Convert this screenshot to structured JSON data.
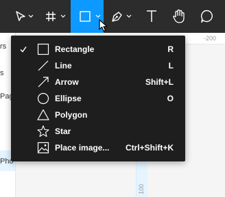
{
  "toolbar": {
    "tools": [
      {
        "name": "move-tool"
      },
      {
        "name": "frame-tool"
      },
      {
        "name": "shape-tool",
        "active": true
      },
      {
        "name": "pen-tool"
      },
      {
        "name": "text-tool"
      },
      {
        "name": "hand-tool"
      },
      {
        "name": "comment-tool"
      }
    ],
    "accent_color": "#0d99ff"
  },
  "left_panel": {
    "fragments": [
      "rs",
      "s",
      "Pag",
      "Pho"
    ]
  },
  "ruler": {
    "top_label": "-200",
    "left_label": "100"
  },
  "menu": {
    "items": [
      {
        "label": "Rectangle",
        "shortcut": "R",
        "icon": "rectangle-icon",
        "checked": true
      },
      {
        "label": "Line",
        "shortcut": "L",
        "icon": "line-icon",
        "checked": false
      },
      {
        "label": "Arrow",
        "shortcut": "Shift+L",
        "icon": "arrow-icon",
        "checked": false
      },
      {
        "label": "Ellipse",
        "shortcut": "O",
        "icon": "ellipse-icon",
        "checked": false
      },
      {
        "label": "Polygon",
        "shortcut": "",
        "icon": "polygon-icon",
        "checked": false
      },
      {
        "label": "Star",
        "shortcut": "",
        "icon": "star-icon",
        "checked": false
      },
      {
        "label": "Place image...",
        "shortcut": "Ctrl+Shift+K",
        "icon": "image-icon",
        "checked": false
      }
    ]
  }
}
